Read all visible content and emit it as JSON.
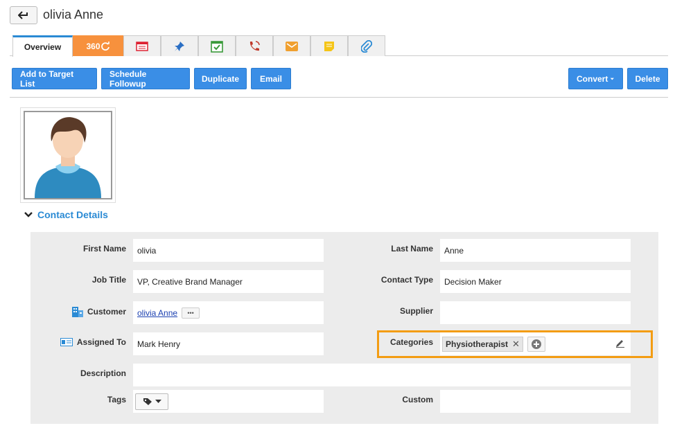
{
  "header": {
    "title": "olivia Anne"
  },
  "tabs": [
    {
      "name": "tab-overview",
      "label": "Overview"
    },
    {
      "name": "tab-360",
      "label": "360"
    },
    {
      "name": "tab-calendar-icon",
      "label": ""
    },
    {
      "name": "tab-pin-icon",
      "label": ""
    },
    {
      "name": "tab-task-icon",
      "label": ""
    },
    {
      "name": "tab-call-icon",
      "label": ""
    },
    {
      "name": "tab-email-icon",
      "label": ""
    },
    {
      "name": "tab-notes-icon",
      "label": ""
    },
    {
      "name": "tab-attachment-icon",
      "label": ""
    }
  ],
  "actions": {
    "add_to_target": "Add to Target List",
    "schedule_followup": "Schedule Followup",
    "duplicate": "Duplicate",
    "email": "Email",
    "convert": "Convert",
    "delete": "Delete"
  },
  "section": {
    "title": "Contact Details"
  },
  "fields": {
    "first_name": {
      "label": "First Name",
      "value": "olivia"
    },
    "last_name": {
      "label": "Last Name",
      "value": "Anne"
    },
    "job_title": {
      "label": "Job Title",
      "value": "VP, Creative Brand Manager"
    },
    "contact_type": {
      "label": "Contact Type",
      "value": "Decision Maker"
    },
    "customer": {
      "label": "Customer",
      "value": "olivia Anne"
    },
    "supplier": {
      "label": "Supplier",
      "value": ""
    },
    "assigned_to": {
      "label": "Assigned To",
      "value": "Mark Henry"
    },
    "categories": {
      "label": "Categories",
      "chip": "Physiotherapist"
    },
    "description": {
      "label": "Description",
      "value": ""
    },
    "tags": {
      "label": "Tags"
    },
    "custom": {
      "label": "Custom",
      "value": ""
    }
  },
  "colors": {
    "accent": "#3a8ee6",
    "tab_360": "#f7913d",
    "highlight": "#f39c12",
    "panel": "#ececec"
  }
}
